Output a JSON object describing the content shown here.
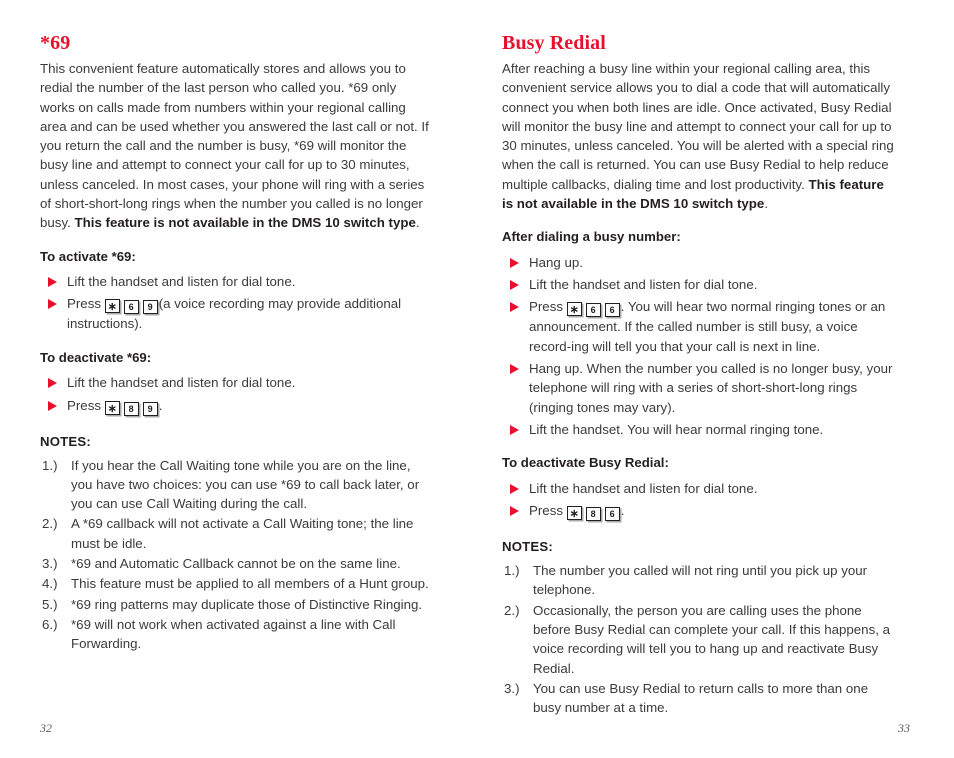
{
  "left_page": {
    "folio": "32",
    "title": "*69",
    "intro_segments": [
      {
        "text": "This convenient feature automatically stores and allows you to redial the number of the last person who called you. *69 only works on calls made from numbers within your regional calling area and can be used whether you answered the last call or not. If you return the call and the number is busy, *69 will monitor the busy line and attempt to connect your call for up to 30 minutes, unless canceled. In most cases, your phone will ring with a series of short-short-long rings when the number you called is no longer busy. ",
        "bold": false
      },
      {
        "text": "This feature is not available in the DMS 10 switch type",
        "bold": true
      },
      {
        "text": ".",
        "bold": false
      }
    ],
    "activate_heading": "To activate *69:",
    "activate_steps": [
      {
        "pre": "Lift the handset and listen for dial tone.",
        "keys": [],
        "post": ""
      },
      {
        "pre": "Press ",
        "keys": [
          "∗",
          "6",
          "9"
        ],
        "post": "(a voice recording may provide additional instructions)."
      }
    ],
    "deactivate_heading": "To deactivate *69:",
    "deactivate_steps": [
      {
        "pre": "Lift the handset and listen for dial tone.",
        "keys": [],
        "post": ""
      },
      {
        "pre": "Press ",
        "keys": [
          "∗",
          "8",
          "9"
        ],
        "post": "."
      }
    ],
    "notes_heading": "NOTES:",
    "notes": [
      {
        "num": "1.)",
        "text": "If you hear the Call Waiting tone while you are on the line, you have two choices: you can use *69 to call back later, or you can use Call Waiting during the call."
      },
      {
        "num": "2.)",
        "text": "A *69 callback will not activate a Call Waiting tone; the line must be idle."
      },
      {
        "num": "3.)",
        "text": "*69 and Automatic Callback cannot be on the same line."
      },
      {
        "num": "4.)",
        "text": "This feature must be applied to all members of a Hunt group."
      },
      {
        "num": "5.)",
        "text": "*69 ring patterns may duplicate those of Distinctive Ringing."
      },
      {
        "num": "6.)",
        "text": "*69 will not work when activated against a line with Call Forwarding."
      }
    ]
  },
  "right_page": {
    "folio": "33",
    "title": "Busy Redial",
    "intro_segments": [
      {
        "text": "After reaching a busy line within your regional calling area, this convenient service allows you to dial a code that will automatically connect you when both lines are idle. Once activated, Busy Redial will monitor the busy line and attempt to connect your call for up to 30 minutes, unless canceled. You will be alerted with a special ring when the call is returned. You can use Busy Redial to help reduce multiple callbacks, dialing time and lost productivity. ",
        "bold": false
      },
      {
        "text": "This feature is not available in the DMS 10 switch type",
        "bold": true
      },
      {
        "text": ".",
        "bold": false
      }
    ],
    "after_dialing_heading": "After dialing a busy number:",
    "after_dialing_steps": [
      {
        "pre": "Hang up.",
        "keys": [],
        "post": ""
      },
      {
        "pre": "Lift the handset and listen for dial tone.",
        "keys": [],
        "post": ""
      },
      {
        "pre": "Press ",
        "keys": [
          "∗",
          "6",
          "6"
        ],
        "post": ". You will hear two normal ringing tones or an announcement. If the called number is still busy, a voice record-ing will tell you that your call is next in line."
      },
      {
        "pre": "Hang up. When the number you called is no longer busy, your telephone will ring with a series of short-short-long rings (ringing tones may vary).",
        "keys": [],
        "post": ""
      },
      {
        "pre": "Lift the handset. You will hear normal ringing tone.",
        "keys": [],
        "post": ""
      }
    ],
    "deactivate_heading": "To deactivate Busy Redial:",
    "deactivate_steps": [
      {
        "pre": "Lift the handset and listen for dial tone.",
        "keys": [],
        "post": ""
      },
      {
        "pre": "Press ",
        "keys": [
          "∗",
          "8",
          "6"
        ],
        "post": "."
      }
    ],
    "notes_heading": "NOTES:",
    "notes": [
      {
        "num": "1.)",
        "text": "The number you called will not ring until you pick up your telephone."
      },
      {
        "num": "2.)",
        "text": "Occasionally, the person you are calling uses the phone before Busy Redial can complete your call. If this happens, a voice recording will tell you to hang up and reactivate Busy Redial."
      },
      {
        "num": "3.)",
        "text": "You can use Busy Redial to return calls to more than one busy number at a time."
      }
    ]
  },
  "colors": {
    "accent_red": "#e8112d",
    "body_text": "#3b3b3b",
    "heading_text": "#231f20"
  }
}
